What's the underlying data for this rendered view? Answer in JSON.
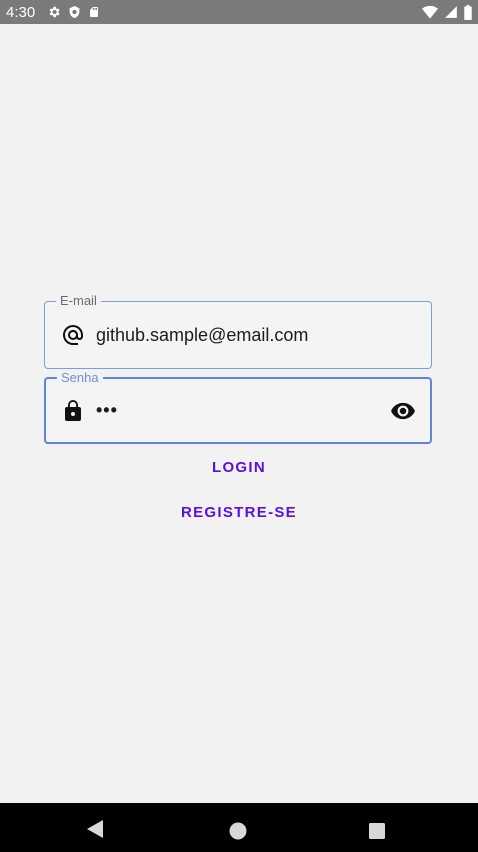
{
  "status_bar": {
    "time": "4:30",
    "left_icons": [
      "gear-icon",
      "shield-icon",
      "sd-card-icon"
    ],
    "right_icons": [
      "wifi-icon",
      "signal-icon",
      "battery-icon"
    ]
  },
  "login_form": {
    "email": {
      "label": "E-mail",
      "value": "github.sample@email.com",
      "icon": "at-sign-icon"
    },
    "password": {
      "label": "Senha",
      "value": "•••",
      "icon": "lock-icon",
      "toggle_icon": "eye-icon"
    },
    "login_label": "LOGIN",
    "register_label": "REGISTRE-SE"
  },
  "colors": {
    "accent": "#5b10e0",
    "field_border": "#7a9ee0",
    "focused_border": "#5f86d6",
    "status_bar": "#7a7a7a",
    "nav_bar": "#000000"
  },
  "nav_bar": {
    "buttons": [
      "back-icon",
      "home-icon",
      "recent-apps-icon"
    ]
  }
}
